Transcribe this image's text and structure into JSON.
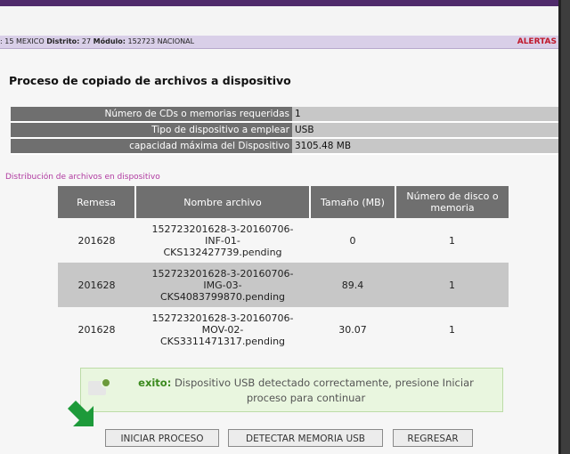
{
  "infobar": {
    "entidad_value": ": 15 MEXICO",
    "distrito_label": "Distrito:",
    "distrito_value": "27",
    "modulo_label": "Módulo:",
    "modulo_value": "152723 NACIONAL",
    "alert_label": "ALERTAS"
  },
  "page_title": "Proceso de copiado de archivos a dispositivo",
  "info_rows": [
    {
      "label": "Número de CDs o memorias requeridas",
      "value": "1"
    },
    {
      "label": "Tipo de dispositivo a emplear",
      "value": "USB"
    },
    {
      "label": "capacidad máxima del Dispositivo",
      "value": "3105.48 MB"
    }
  ],
  "distribution_title": "Distribución de archivos en dispositivo",
  "table": {
    "headers": [
      "Remesa",
      "Nombre archivo",
      "Tamaño (MB)",
      "Número de disco o memoria"
    ],
    "rows": [
      {
        "remesa": "201628",
        "nombre": [
          "152723201628-3-20160706-",
          "INF-01-",
          "CKS132427739.pending"
        ],
        "tamano": "0",
        "disco": "1"
      },
      {
        "remesa": "201628",
        "nombre": [
          "152723201628-3-20160706-",
          "IMG-03-",
          "CKS4083799870.pending"
        ],
        "tamano": "89.4",
        "disco": "1"
      },
      {
        "remesa": "201628",
        "nombre": [
          "152723201628-3-20160706-",
          "MOV-02-",
          "CKS3311471317.pending"
        ],
        "tamano": "30.07",
        "disco": "1"
      }
    ]
  },
  "success": {
    "label": "exito:",
    "message": "Dispositivo USB detectado correctamente, presione Iniciar proceso para continuar"
  },
  "buttons": {
    "iniciar": "INICIAR PROCESO",
    "detectar": "DETECTAR MEMORIA USB",
    "regresar": "REGRESAR"
  },
  "colors": {
    "header_purple": "#4f2a6b",
    "info_bar": "#d9cfe8",
    "alert_red": "#c0182b",
    "success_green": "#3b8a1e",
    "arrow_green": "#1d9a3a"
  }
}
